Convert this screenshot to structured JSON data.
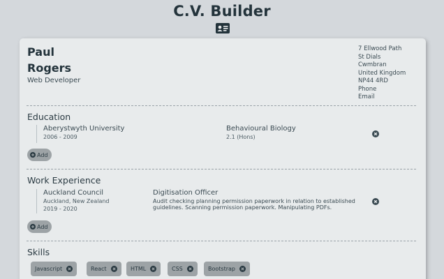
{
  "app": {
    "title": "C.V. Builder",
    "icon": "id-card-icon"
  },
  "person": {
    "first_name": "Paul",
    "last_name": "Rogers",
    "job_title": "Web Developer",
    "address": [
      "7 Ellwood Path",
      "St Dials",
      "Cwmbran",
      "United Kingdom",
      "NP44 4RD",
      "Phone",
      "Email"
    ]
  },
  "education": {
    "title": "Education",
    "entries": [
      {
        "institution": "Aberystwyth University",
        "dates": "2006 - 2009",
        "subject": "Behavioural Biology",
        "grade": "2.1 (Hons)"
      }
    ],
    "add_label": "Add"
  },
  "work": {
    "title": "Work Experience",
    "entries": [
      {
        "company": "Auckland Council",
        "location": "Auckland, New Zealand",
        "dates": "2019 - 2020",
        "position": "Digitisation Officer",
        "description": "Audit checking planning permission paperwork in relation to established guidelines. Scanning permission paperwork. Manipulating PDFs."
      }
    ],
    "add_label": "Add"
  },
  "skills": {
    "title": "Skills",
    "items": [
      "Javascript",
      "React",
      "HTML",
      "CSS",
      "Bootstrap"
    ]
  },
  "colors": {
    "background": "#d4d8dc",
    "card": "#e8ebec",
    "chip": "#9da3a6",
    "text": "#23333b"
  }
}
